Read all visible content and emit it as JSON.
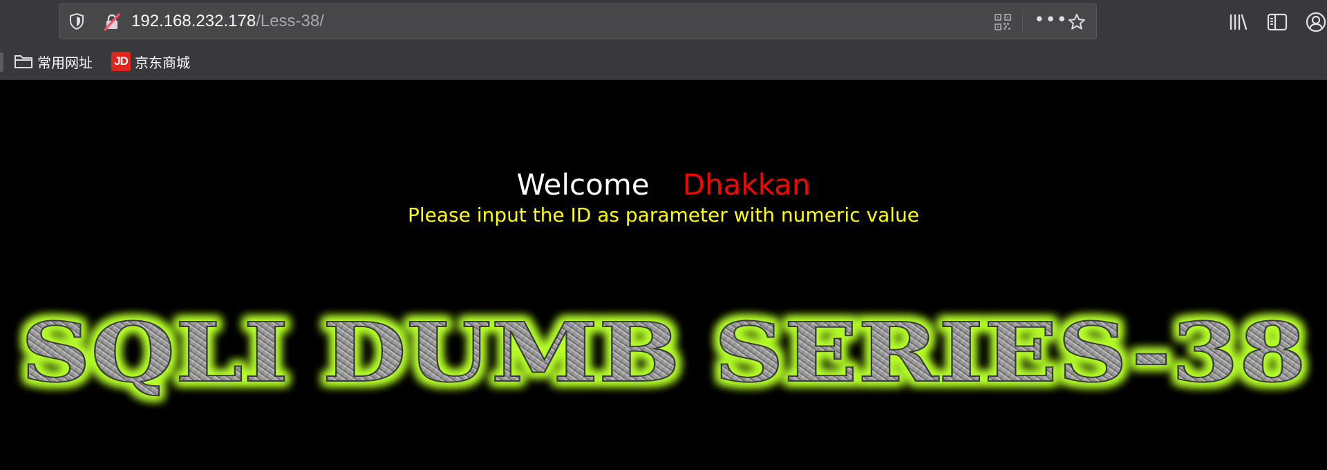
{
  "browser": {
    "url": {
      "host": "192.168.232.178",
      "path": "/Less-38/"
    },
    "icons": {
      "tracking_protection": "shield-icon",
      "connection": "insecure-lock-icon",
      "qr": "qr-code-icon",
      "page_actions": "more-dots-icon",
      "bookmark": "star-icon",
      "library": "library-icon",
      "sidebar": "sidebar-icon",
      "account": "account-icon"
    },
    "page_actions_glyph": "•••",
    "bookmarks": [
      {
        "label": "常用网址",
        "icon": "folder-icon"
      },
      {
        "label": "京东商城",
        "icon": "jd-logo-icon",
        "badge_text": "JD"
      }
    ]
  },
  "page": {
    "welcome": "Welcome",
    "name": "Dhakkan",
    "instruction": "Please input the ID as parameter with numeric value",
    "banner_text": "SQLI DUMB SERIES-38"
  },
  "colors": {
    "background": "#000000",
    "welcome": "#ffffff",
    "name": "#ff0000",
    "instruction": "#ffff00",
    "banner_glow": "#b6ff2a",
    "banner_metal": "#9a9a9a",
    "chrome": "#38383d",
    "urlbar": "#474749"
  }
}
